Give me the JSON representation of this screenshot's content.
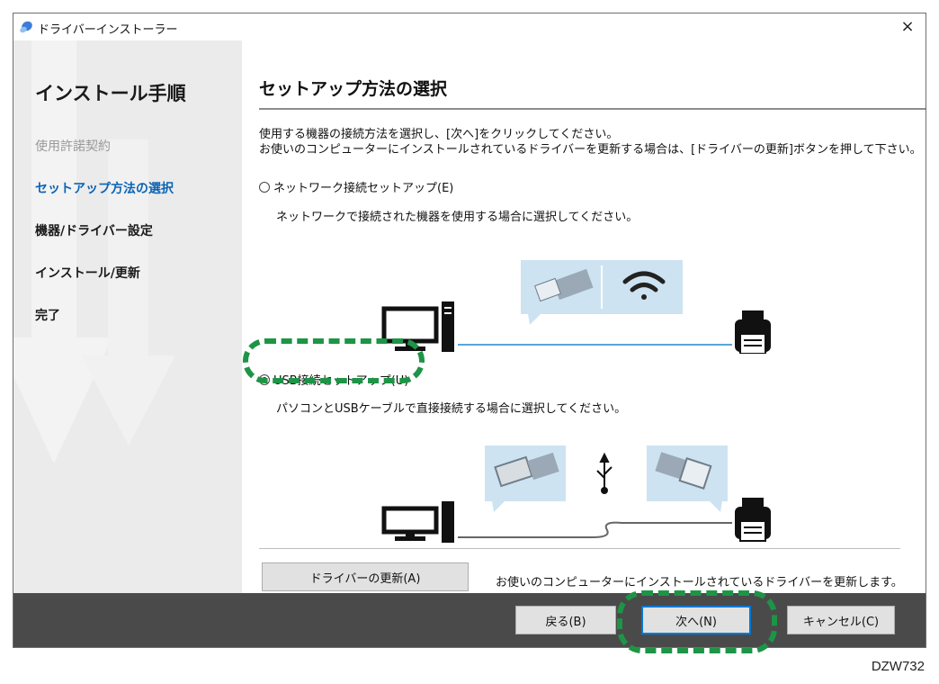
{
  "window": {
    "title": "ドライバーインストーラー",
    "close_label": "×"
  },
  "sidebar": {
    "title": "インストール手順",
    "steps": [
      {
        "label": "使用許諾契約",
        "state": "done"
      },
      {
        "label": "セットアップ方法の選択",
        "state": "active"
      },
      {
        "label": "機器/ドライバー設定",
        "state": "pending"
      },
      {
        "label": "インストール/更新",
        "state": "pending"
      },
      {
        "label": "完了",
        "state": "pending"
      }
    ]
  },
  "main": {
    "heading": "セットアップ方法の選択",
    "description_line1": "使用する機器の接続方法を選択し、[次へ]をクリックしてください。",
    "description_line2": "お使いのコンピューターにインストールされているドライバーを更新する場合は、[ドライバーの更新]ボタンを押して下さい。",
    "options": [
      {
        "label": "ネットワーク接続セットアップ(E)",
        "description": "ネットワークで接続された機器を使用する場合に選択してください。",
        "selected": false
      },
      {
        "label": "USB接続セットアップ(U)",
        "description": "パソコンとUSBケーブルで直接接続する場合に選択してください。",
        "selected": true
      }
    ],
    "update_button": "ドライバーの更新(A)",
    "update_note": "お使いのコンピューターにインストールされているドライバーを更新します。"
  },
  "footer": {
    "back_button": "戻る(B)",
    "next_button": "次へ(N)",
    "cancel_button": "キャンセル(C)"
  },
  "figure_code": "DZW732",
  "colors": {
    "active_step": "#0b64b5",
    "highlight": "#1e9446",
    "footer_bg": "#4a4a4a",
    "diagram_bubble": "#cde3f2"
  }
}
